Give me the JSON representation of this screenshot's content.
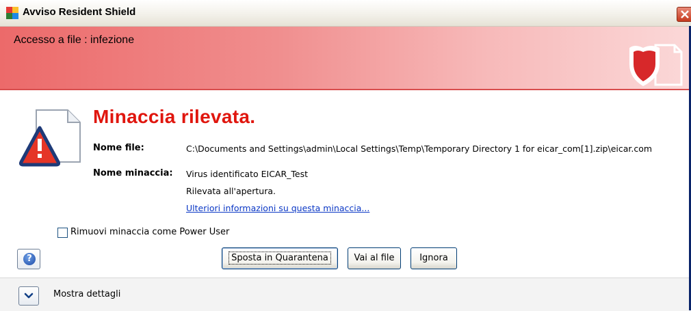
{
  "window": {
    "title": "Avviso Resident Shield"
  },
  "banner": {
    "title": "Accesso a file : infezione"
  },
  "alert": {
    "headline": "Minaccia rilevata.",
    "file_label": "Nome file:",
    "file_value": "C:\\Documents and Settings\\admin\\Local Settings\\Temp\\Temporary Directory 1 for eicar_com[1].zip\\eicar.com",
    "threat_label": "Nome minaccia:",
    "threat_value": "Virus identificato EICAR_Test",
    "detected_text": "Rilevata all'apertura.",
    "more_info_link": "Ulteriori informazioni su questa minaccia..."
  },
  "options": {
    "power_user_label": "Rimuovi minaccia come Power User",
    "power_user_checked": false
  },
  "buttons": {
    "quarantine": "Sposta in Quarantena",
    "goto_file": "Vai al file",
    "ignore": "Ignora"
  },
  "footer": {
    "details_label": "Mostra dettagli"
  },
  "colors": {
    "headline": "#e0160e",
    "banner": "#ec6a6a",
    "link": "#0a37c5"
  },
  "icons": {
    "title": "avg-logo-icon",
    "close": "close-icon",
    "banner": "shield-document-icon",
    "alert": "warning-document-icon",
    "help": "help-icon",
    "expand": "chevron-down-icon"
  }
}
